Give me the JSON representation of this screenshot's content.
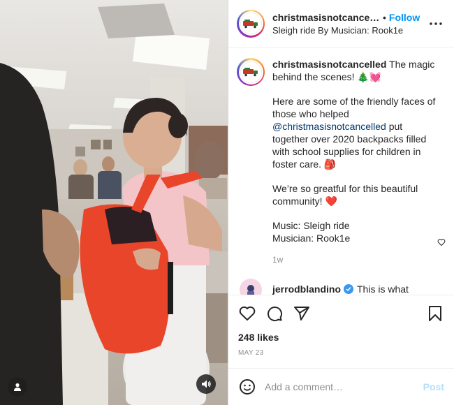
{
  "post": {
    "username": "christmasisnotcancelled",
    "header_username": "christmasisnotcancelle",
    "dot": "•",
    "follow_label": "Follow",
    "audio_line": "Sleigh ride By Musician: Rook1e",
    "caption": {
      "intro": "The magic behind the scenes! 🎄💓",
      "para2_before": "Here are some of the friendly faces of those who helped",
      "mention": "@christmasisnotcancelled",
      "para2_after": "put together over 2020 backpacks filled with school supplies for children in foster care. 🎒",
      "para3": "We’re so greatful for this beautiful community! ❤️",
      "music_line": "Music: Sleigh ride",
      "musician_line": "Musician: Rook1e"
    },
    "time_ago": "1w",
    "likes": "248 likes",
    "date": "MAY 23"
  },
  "comment": {
    "username": "jerrodblandino",
    "text": "This is what"
  },
  "comment_box": {
    "placeholder": "Add a comment…",
    "post_label": "Post"
  },
  "icons": {
    "more": "more-horizontal-icon",
    "like": "heart-icon",
    "comment": "comment-bubble-icon",
    "share": "paper-plane-icon",
    "save": "bookmark-icon",
    "emoji": "smiley-icon",
    "user_tag": "person-icon",
    "audio": "speaker-icon",
    "verified": "verified-badge-icon"
  },
  "colors": {
    "accent": "#0095f6",
    "post_disabled": "#b2dffc",
    "mention": "#00376b",
    "backpack": "#e8452a"
  }
}
